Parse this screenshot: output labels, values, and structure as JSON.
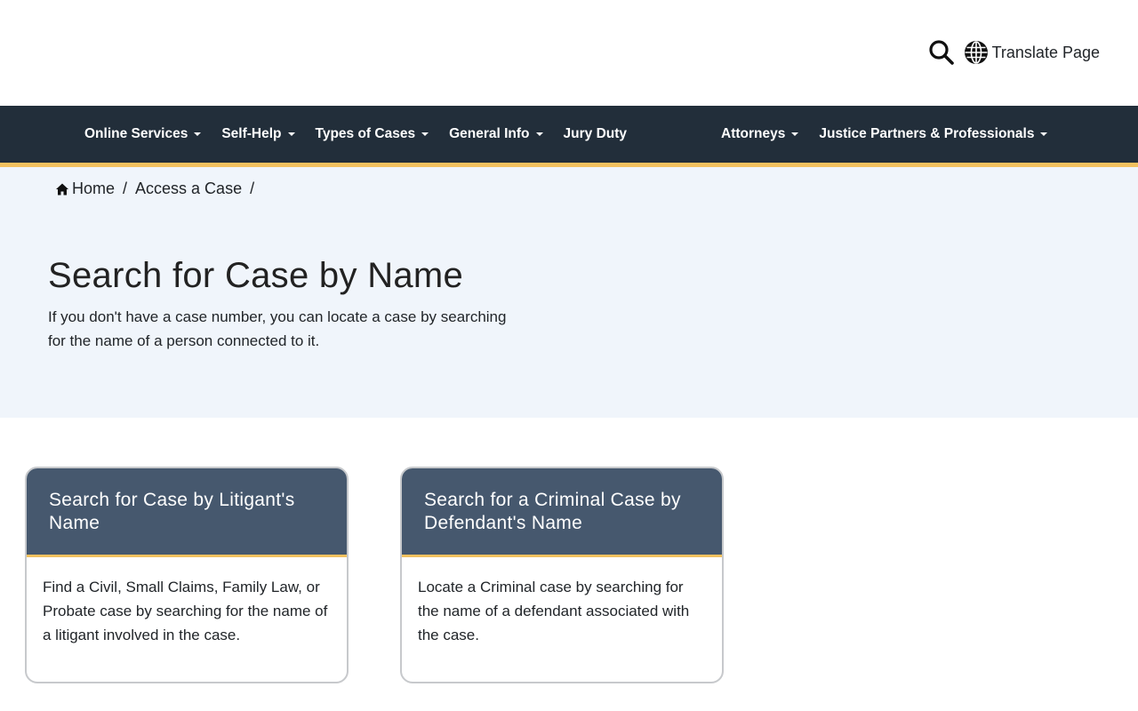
{
  "header": {
    "search_icon": "search-icon",
    "translate_label": "Translate Page",
    "globe_icon": "globe-icon"
  },
  "nav": {
    "left": [
      {
        "label": "Online Services",
        "dropdown": true
      },
      {
        "label": "Self-Help",
        "dropdown": true
      },
      {
        "label": "Types of Cases",
        "dropdown": true
      },
      {
        "label": "General Info",
        "dropdown": true
      },
      {
        "label": "Jury Duty",
        "dropdown": false
      }
    ],
    "right": [
      {
        "label": "Attorneys",
        "dropdown": true
      },
      {
        "label": "Justice Partners & Professionals",
        "dropdown": true
      }
    ]
  },
  "breadcrumb": {
    "items": [
      "Home",
      "Access a Case"
    ],
    "separator": "/"
  },
  "page": {
    "title": "Search for Case by Name",
    "description": "If you don't have a case number, you can locate a case by searching for the name of a person connected to it."
  },
  "cards": [
    {
      "title": "Search for Case by Litigant's Name",
      "body": "Find a Civil, Small Claims, Family Law, or Probate case by searching for the name of a litigant involved in the case."
    },
    {
      "title": "Search for a Criminal Case by Defendant's Name",
      "body": "Locate a Criminal case by searching for the name of a defendant associated with the case."
    }
  ],
  "colors": {
    "nav_bg": "#222e3a",
    "accent": "#f3c15f",
    "hero_bg": "#f0f5fb",
    "card_header": "#46586e"
  }
}
